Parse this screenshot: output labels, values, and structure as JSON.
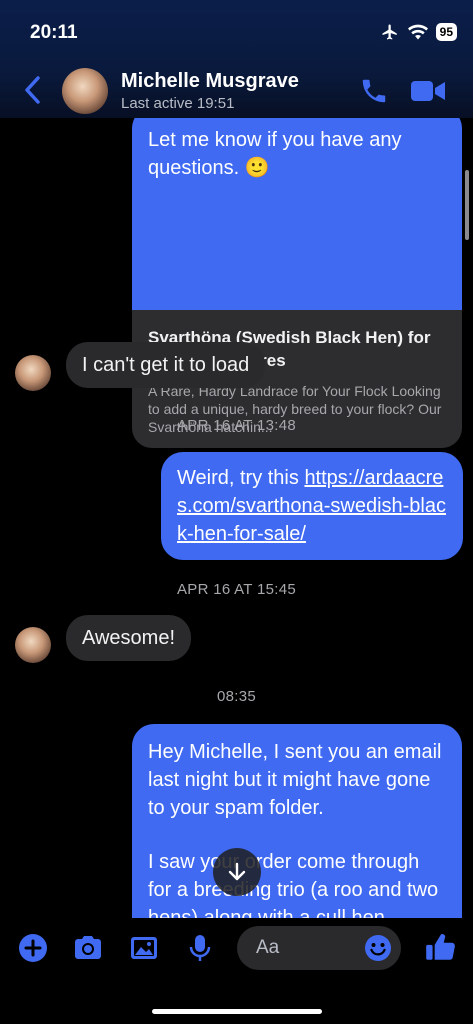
{
  "status_bar": {
    "time": "20:11",
    "battery": "95"
  },
  "header": {
    "contact_name": "Michelle Musgrave",
    "last_active": "Last active 19:51"
  },
  "messages": {
    "link_card": {
      "text": "Let me know if you have any questions. 🙂",
      "preview_title": "Svarthöna (Swedish Black Hen) for sale - Arda Acres",
      "preview_desc": "A Rare, Hardy Landrace for Your Flock Looking to add a unique, hardy breed to your flock? Our Svarthöna hatchin..."
    },
    "msg_cant_load": "I can't get it to load",
    "ts1": "APR 16 AT 13:48",
    "msg_weird_prefix": "Weird, try this ",
    "msg_weird_link": "https://ardaacres.com/svarthona-swedish-black-hen-for-sale/",
    "ts2": "APR 16 AT 15:45",
    "msg_awesome": "Awesome!",
    "ts3": "08:35",
    "msg_long_p1": "Hey Michelle, I sent you an email last night but it might have gone to your spam folder.",
    "msg_long_p2": "I saw your order come through for a breeding trio (a roo and two hens) along with a cull hen"
  },
  "composer": {
    "placeholder": "Aa"
  },
  "colors": {
    "accent": "#3f6af1",
    "incoming_bubble": "#2a2a2d",
    "icon_blue": "#3f6af1"
  },
  "icons": [
    "back-chevron",
    "phone",
    "video-camera",
    "plus",
    "camera",
    "image",
    "microphone",
    "emoji",
    "thumbs-up",
    "arrow-down",
    "airplane",
    "wifi"
  ]
}
